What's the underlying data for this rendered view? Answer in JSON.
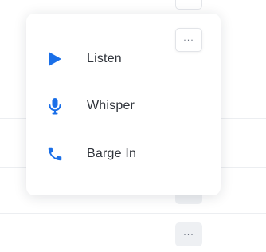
{
  "accent_color": "#1a6fe8",
  "background_rows": {
    "more_buttons": [
      {
        "label": "···",
        "icon": "more-horizontal-icon"
      },
      {
        "label": "···",
        "icon": "more-horizontal-icon"
      }
    ]
  },
  "menu": {
    "trigger": {
      "label": "···",
      "icon": "more-horizontal-icon"
    },
    "items": [
      {
        "label": "Listen",
        "icon": "play-icon"
      },
      {
        "label": "Whisper",
        "icon": "microphone-icon"
      },
      {
        "label": "Barge In",
        "icon": "phone-icon"
      }
    ]
  }
}
